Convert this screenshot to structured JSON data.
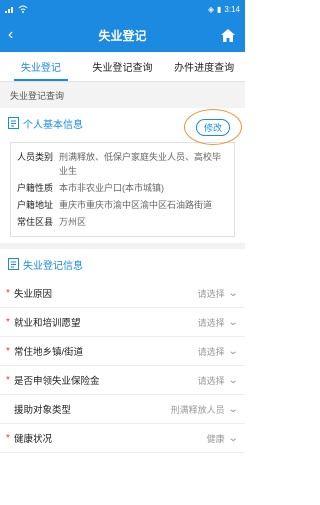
{
  "status": {
    "time": "3:14",
    "battery": "▮"
  },
  "nav": {
    "title": "失业登记"
  },
  "tabs": [
    {
      "label": "失业登记"
    },
    {
      "label": "失业登记查询"
    },
    {
      "label": "办件进度查询"
    }
  ],
  "subheader": "失业登记查询",
  "personal": {
    "title": "个人基本信息",
    "edit_label": "修改",
    "rows": [
      {
        "k": "人员类别",
        "v": "刑满释放、低保户家庭失业人员、高校毕业生"
      },
      {
        "k": "户籍性质",
        "v": "本市非农业户口(本市城镇)"
      },
      {
        "k": "户籍地址",
        "v": "重庆市重庆市渝中区渝中区石油路街道"
      },
      {
        "k": "常住区县",
        "v": "万州区"
      }
    ]
  },
  "registration": {
    "title": "失业登记信息",
    "fields": [
      {
        "label": "失业原因",
        "value": "请选择",
        "required": true
      },
      {
        "label": "就业和培训愿望",
        "value": "请选择",
        "required": true
      },
      {
        "label": "常住地乡镇/街道",
        "value": "请选择",
        "required": true
      },
      {
        "label": "是否申领失业保险金",
        "value": "请选择",
        "required": true
      },
      {
        "label": "援助对象类型",
        "value": "刑满释放人员",
        "required": false
      },
      {
        "label": "健康状况",
        "value": "健康",
        "required": true
      }
    ]
  }
}
